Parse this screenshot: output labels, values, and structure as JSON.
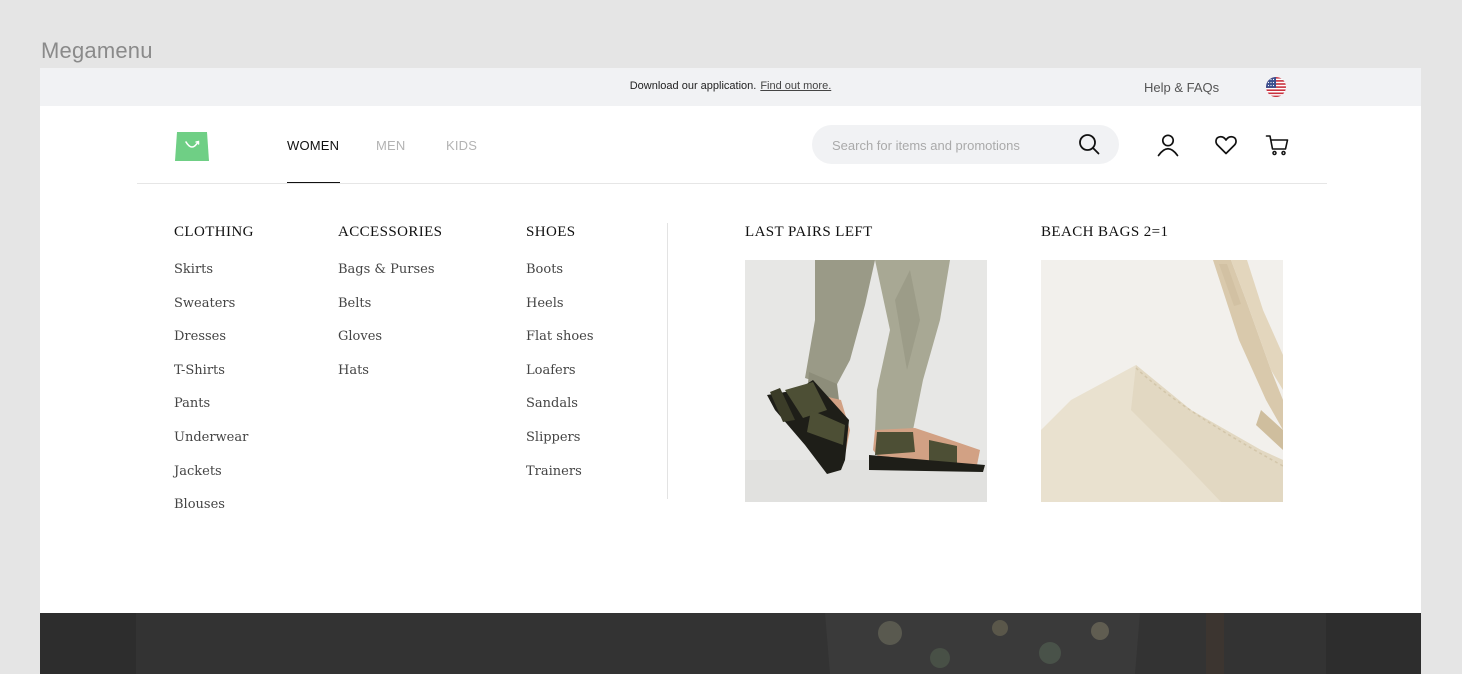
{
  "frame_title": "Megamenu",
  "topbar": {
    "promo_text": "Download our application.",
    "promo_link": "Find out more.",
    "help": "Help & FAQs",
    "flag_icon": "us-flag-icon"
  },
  "nav": {
    "tabs": [
      {
        "label": "WOMEN",
        "active": true
      },
      {
        "label": "MEN",
        "active": false
      },
      {
        "label": "KIDS",
        "active": false
      }
    ],
    "search_placeholder": "Search for items and promotions",
    "icons": [
      "search-icon",
      "user-icon",
      "heart-icon",
      "cart-icon"
    ]
  },
  "menu": {
    "clothing": {
      "heading": "CLOTHING",
      "items": [
        "Skirts",
        "Sweaters",
        "Dresses",
        "T-Shirts",
        "Pants",
        "Underwear",
        "Jackets",
        "Blouses"
      ]
    },
    "accessories": {
      "heading": "ACCESSORIES",
      "items": [
        "Bags & Purses",
        "Belts",
        "Gloves",
        "Hats"
      ]
    },
    "shoes": {
      "heading": "SHOES",
      "items": [
        "Boots",
        "Heels",
        "Flat shoes",
        "Loafers",
        "Sandals",
        "Slippers",
        "Trainers"
      ]
    }
  },
  "promos": [
    {
      "heading": "LAST PAIRS LEFT"
    },
    {
      "heading": "BEACH BAGS 2=1"
    }
  ],
  "colors": {
    "brand_green": "#6fcf85",
    "topbar_bg": "#f1f2f4",
    "canvas_bg": "#e5e5e5",
    "footer_dark": "#2d2d2d"
  }
}
